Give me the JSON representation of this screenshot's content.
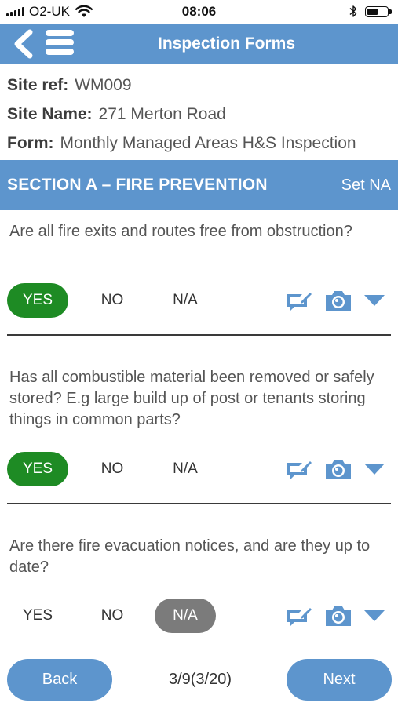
{
  "status_bar": {
    "carrier": "O2-UK",
    "time": "08:06",
    "battery_level": 0.55
  },
  "header": {
    "title": "Inspection Forms"
  },
  "info": {
    "site_ref_label": "Site ref:",
    "site_ref_value": "WM009",
    "site_name_label": "Site Name:",
    "site_name_value": "271 Merton Road",
    "form_label": "Form:",
    "form_value": "Monthly Managed Areas H&S Inspection"
  },
  "section": {
    "title": "SECTION A – FIRE PREVENTION",
    "set_na_label": "Set NA"
  },
  "questions": [
    {
      "text": "Are all fire exits and routes free from obstruction?",
      "yes": "YES",
      "no": "NO",
      "na": "N/A",
      "selected": "YES"
    },
    {
      "text": "Has all combustible material been removed or safely stored? E.g large build up of post or tenants storing things in common parts?",
      "yes": "YES",
      "no": "NO",
      "na": "N/A",
      "selected": "YES"
    },
    {
      "text": "Are there fire evacuation notices, and are they up to date?",
      "yes": "YES",
      "no": "NO",
      "na": "N/A",
      "selected": "N/A"
    }
  ],
  "footer": {
    "back_label": "Back",
    "page_indicator": "3/9(3/20)",
    "next_label": "Next"
  },
  "colors": {
    "accent": "#5d95cd",
    "yes_selected": "#1e8b24",
    "na_selected": "#7b7b7b"
  },
  "icons": [
    "back-chevron-icon",
    "menu-icon",
    "wifi-icon",
    "bluetooth-icon",
    "battery-icon",
    "comment-edit-icon",
    "camera-icon",
    "expand-down-icon"
  ]
}
